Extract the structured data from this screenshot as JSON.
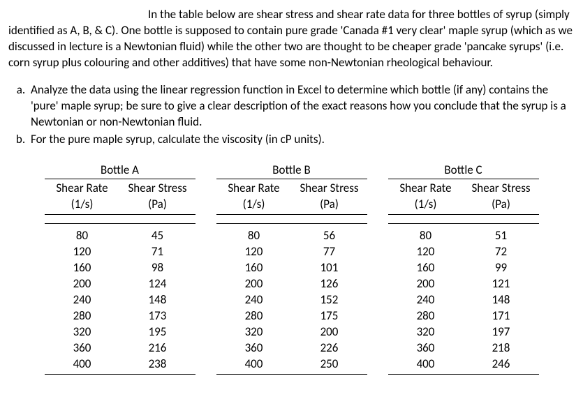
{
  "intro": {
    "p1": "In the table below are shear stress and shear rate data for three bottles of syrup (simply identified as A, B, & C).  One bottle is supposed to contain pure grade 'Canada #1 very clear' maple syrup (which as we discussed in lecture is a Newtonian fluid) while the other two are thought to be cheaper grade 'pancake syrups' (i.e. corn syrup plus colouring and other additives) that have some non-Newtonian rheological behaviour."
  },
  "questions": {
    "a": "Analyze the data using the linear regression function in Excel to determine which bottle (if any) contains the 'pure' maple syrup; be sure to give a clear description of the exact reasons how you conclude that the syrup is a Newtonian or non-Newtonian fluid.",
    "b": "For the pure maple syrup, calculate the viscosity (in cP units)."
  },
  "columns": {
    "rate_label": "Shear Rate",
    "rate_unit": "(1/s)",
    "stress_label": "Shear Stress",
    "stress_unit": "(Pa)"
  },
  "bottles": {
    "A": {
      "title": "Bottle A",
      "rate": [
        80,
        120,
        160,
        200,
        240,
        280,
        320,
        360,
        400
      ],
      "stress": [
        45,
        71,
        98,
        124,
        148,
        173,
        195,
        216,
        238
      ]
    },
    "B": {
      "title": "Bottle B",
      "rate": [
        80,
        120,
        160,
        200,
        240,
        280,
        320,
        360,
        400
      ],
      "stress": [
        56,
        77,
        101,
        126,
        152,
        175,
        200,
        226,
        250
      ]
    },
    "C": {
      "title": "Bottle C",
      "rate": [
        80,
        120,
        160,
        200,
        240,
        280,
        320,
        360,
        400
      ],
      "stress": [
        51,
        72,
        99,
        121,
        148,
        171,
        197,
        218,
        246
      ]
    }
  }
}
